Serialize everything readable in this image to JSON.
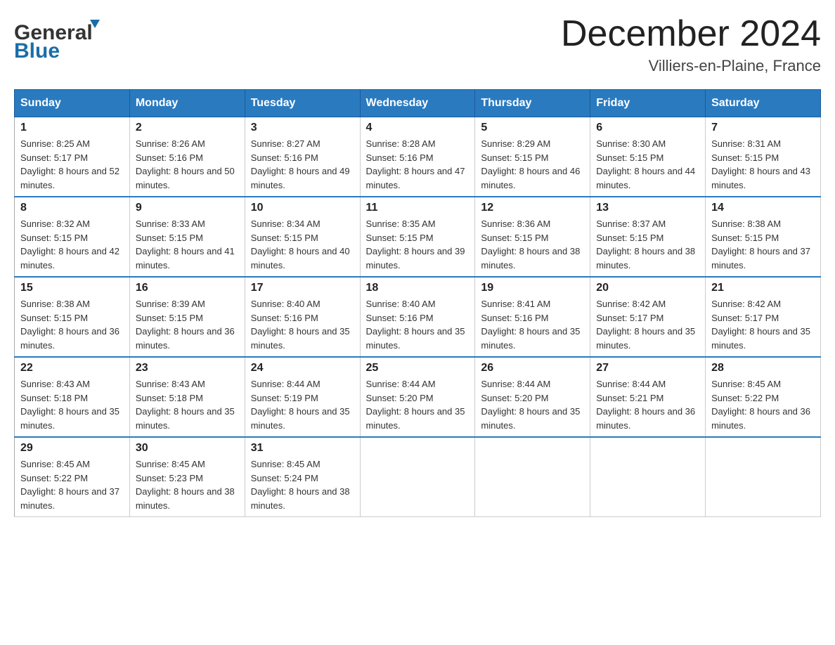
{
  "header": {
    "logo_general": "General",
    "logo_blue": "Blue",
    "month_year": "December 2024",
    "location": "Villiers-en-Plaine, France"
  },
  "weekdays": [
    "Sunday",
    "Monday",
    "Tuesday",
    "Wednesday",
    "Thursday",
    "Friday",
    "Saturday"
  ],
  "weeks": [
    [
      {
        "day": "1",
        "sunrise": "8:25 AM",
        "sunset": "5:17 PM",
        "daylight": "8 hours and 52 minutes."
      },
      {
        "day": "2",
        "sunrise": "8:26 AM",
        "sunset": "5:16 PM",
        "daylight": "8 hours and 50 minutes."
      },
      {
        "day": "3",
        "sunrise": "8:27 AM",
        "sunset": "5:16 PM",
        "daylight": "8 hours and 49 minutes."
      },
      {
        "day": "4",
        "sunrise": "8:28 AM",
        "sunset": "5:16 PM",
        "daylight": "8 hours and 47 minutes."
      },
      {
        "day": "5",
        "sunrise": "8:29 AM",
        "sunset": "5:15 PM",
        "daylight": "8 hours and 46 minutes."
      },
      {
        "day": "6",
        "sunrise": "8:30 AM",
        "sunset": "5:15 PM",
        "daylight": "8 hours and 44 minutes."
      },
      {
        "day": "7",
        "sunrise": "8:31 AM",
        "sunset": "5:15 PM",
        "daylight": "8 hours and 43 minutes."
      }
    ],
    [
      {
        "day": "8",
        "sunrise": "8:32 AM",
        "sunset": "5:15 PM",
        "daylight": "8 hours and 42 minutes."
      },
      {
        "day": "9",
        "sunrise": "8:33 AM",
        "sunset": "5:15 PM",
        "daylight": "8 hours and 41 minutes."
      },
      {
        "day": "10",
        "sunrise": "8:34 AM",
        "sunset": "5:15 PM",
        "daylight": "8 hours and 40 minutes."
      },
      {
        "day": "11",
        "sunrise": "8:35 AM",
        "sunset": "5:15 PM",
        "daylight": "8 hours and 39 minutes."
      },
      {
        "day": "12",
        "sunrise": "8:36 AM",
        "sunset": "5:15 PM",
        "daylight": "8 hours and 38 minutes."
      },
      {
        "day": "13",
        "sunrise": "8:37 AM",
        "sunset": "5:15 PM",
        "daylight": "8 hours and 38 minutes."
      },
      {
        "day": "14",
        "sunrise": "8:38 AM",
        "sunset": "5:15 PM",
        "daylight": "8 hours and 37 minutes."
      }
    ],
    [
      {
        "day": "15",
        "sunrise": "8:38 AM",
        "sunset": "5:15 PM",
        "daylight": "8 hours and 36 minutes."
      },
      {
        "day": "16",
        "sunrise": "8:39 AM",
        "sunset": "5:15 PM",
        "daylight": "8 hours and 36 minutes."
      },
      {
        "day": "17",
        "sunrise": "8:40 AM",
        "sunset": "5:16 PM",
        "daylight": "8 hours and 35 minutes."
      },
      {
        "day": "18",
        "sunrise": "8:40 AM",
        "sunset": "5:16 PM",
        "daylight": "8 hours and 35 minutes."
      },
      {
        "day": "19",
        "sunrise": "8:41 AM",
        "sunset": "5:16 PM",
        "daylight": "8 hours and 35 minutes."
      },
      {
        "day": "20",
        "sunrise": "8:42 AM",
        "sunset": "5:17 PM",
        "daylight": "8 hours and 35 minutes."
      },
      {
        "day": "21",
        "sunrise": "8:42 AM",
        "sunset": "5:17 PM",
        "daylight": "8 hours and 35 minutes."
      }
    ],
    [
      {
        "day": "22",
        "sunrise": "8:43 AM",
        "sunset": "5:18 PM",
        "daylight": "8 hours and 35 minutes."
      },
      {
        "day": "23",
        "sunrise": "8:43 AM",
        "sunset": "5:18 PM",
        "daylight": "8 hours and 35 minutes."
      },
      {
        "day": "24",
        "sunrise": "8:44 AM",
        "sunset": "5:19 PM",
        "daylight": "8 hours and 35 minutes."
      },
      {
        "day": "25",
        "sunrise": "8:44 AM",
        "sunset": "5:20 PM",
        "daylight": "8 hours and 35 minutes."
      },
      {
        "day": "26",
        "sunrise": "8:44 AM",
        "sunset": "5:20 PM",
        "daylight": "8 hours and 35 minutes."
      },
      {
        "day": "27",
        "sunrise": "8:44 AM",
        "sunset": "5:21 PM",
        "daylight": "8 hours and 36 minutes."
      },
      {
        "day": "28",
        "sunrise": "8:45 AM",
        "sunset": "5:22 PM",
        "daylight": "8 hours and 36 minutes."
      }
    ],
    [
      {
        "day": "29",
        "sunrise": "8:45 AM",
        "sunset": "5:22 PM",
        "daylight": "8 hours and 37 minutes."
      },
      {
        "day": "30",
        "sunrise": "8:45 AM",
        "sunset": "5:23 PM",
        "daylight": "8 hours and 38 minutes."
      },
      {
        "day": "31",
        "sunrise": "8:45 AM",
        "sunset": "5:24 PM",
        "daylight": "8 hours and 38 minutes."
      },
      null,
      null,
      null,
      null
    ]
  ]
}
